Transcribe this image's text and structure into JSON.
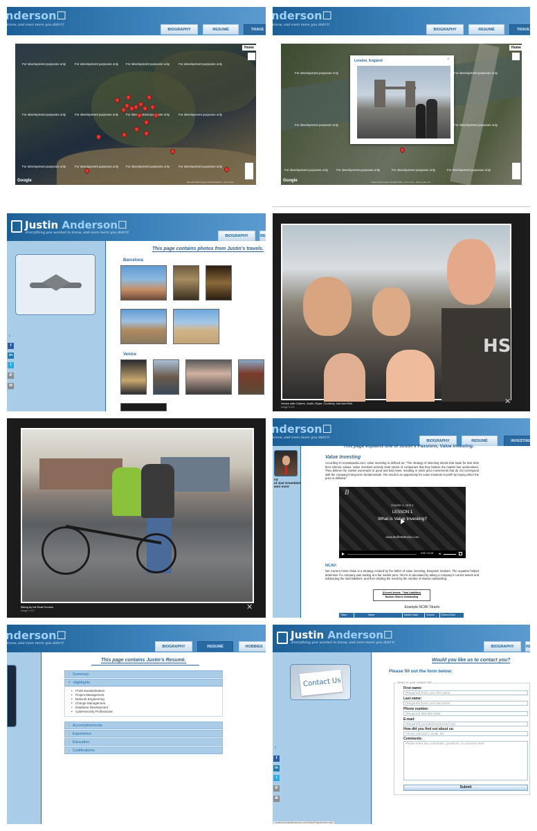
{
  "site": {
    "logo_first": "Justin",
    "logo_last": "Anderson",
    "tagline": "Everything you wanted to know, and even more you didn't!",
    "logo_partial": "nderson",
    "tagline_partial": "know, and even more you didn't!"
  },
  "nav": {
    "biography": "BIOGRAPHY",
    "resume": "RESUMÉ",
    "travels_partial": "TRAVE",
    "investing": "INVESTING",
    "hobbies_partial": "HOBBIES"
  },
  "map": {
    "dev_text": "For development purposes only",
    "home_button": "Home",
    "google_logo": "Google",
    "attribution": "Map data ©2018 Imagery ©2018 TerraMetrics · Terms of Use",
    "attribution_b": "Imagery ©2018 Google, Map data ©2018 · Terms of Use · Report a map error"
  },
  "infowindow": {
    "title": "London, England"
  },
  "travels": {
    "page_title": "This page contains photos from Justin's travels.",
    "section_barcelona": "Barcelona",
    "section_venice": "Venice",
    "back_arrow": "‹"
  },
  "social": {
    "facebook": "f",
    "linkedin": "in",
    "twitter": "t",
    "phone": "✆",
    "email": "✉"
  },
  "lightbox_venice": {
    "caption": "Venice with Colleen, Justin, Ryan, Courtney, and Ash-Rish",
    "counter": "Image 5 of 6",
    "close": "✕"
  },
  "lightbox_bike": {
    "caption": "Biking by the Boat Houses",
    "counter": "Image 3 of 5",
    "close": "✕"
  },
  "investing": {
    "banner_partial": "This page explains one of Justin's Passions, Value Investing.",
    "sidebar_name": "nd",
    "sidebar_quote": "of Joel Greenblatt",
    "sidebar_learn": "earn more",
    "heading1": "Value Investing",
    "para1_link": "Investopedia.com",
    "para1": "According to Investopedia.com, value investing is defined as: \"The strategy of selecting stocks that trade for less than their intrinsic values. Value investors actively seek stocks of companies that they believe the market has undervalued. They believe the market overreacts to good and bad news, resulting in stock price movements that do not correspond with the company's long-term fundamentals. The result is an opportunity for value investors to profit by buying when the price is deflated.\"",
    "video_brand": "B",
    "video_course": "Course 1, Unit 1",
    "video_lesson": "LESSON 1",
    "video_title": "What is Value Investing?",
    "video_site": "www.BuffettsBooks.com",
    "video_time": "0:00 / 11:25",
    "heading2": "NCAV:",
    "para2": "Net Current Asset Value is a strategy created by the father of value investing, Benjamin Graham. The equation helped determine if a company was trading at a fair market price. NCAV is calculated by taking a company's current assets and subtracting the total liabilities, and then dividing the result by the number of shares outstanding.",
    "formula_top": "(Current Assets - Total Liabilities)",
    "formula_bottom": "Number Shares Outstanding",
    "table_caption": "Example NCAV Stocks",
    "table_headers": [
      "Ticker",
      "Name",
      "Market Value",
      "Volume",
      "Return/Cash"
    ]
  },
  "resume": {
    "page_title": "This page contains Justin's Resumé.",
    "sections": [
      "Summary",
      "Highlights",
      "Accomplishments",
      "Experience",
      "Education",
      "Certifications"
    ],
    "highlights": [
      "ITSM standardization",
      "Project Management",
      "Network Engineering",
      "Change Management",
      "Database Development",
      "Cybersecurity Professional"
    ]
  },
  "contact": {
    "page_title": "Would you like us to contact you?",
    "subtitle": "Please fill out the form below:",
    "card_text": "Contact Us",
    "legend": "Send us your contact info",
    "fields": [
      {
        "label": "First name:",
        "placeholder": "(Required) Enter your first name"
      },
      {
        "label": "Last name:",
        "placeholder": "(Required) Enter your last name"
      },
      {
        "label": "Phone number:",
        "placeholder": "(Required) 555-555-5555"
      },
      {
        "label": "E-mail:",
        "placeholder": "(Required) youraddress@email.com"
      },
      {
        "label": "How did you find out about us:",
        "placeholder": "Friend, television, email, etc."
      }
    ],
    "comments_label": "Comments:",
    "comments_placeholder": "Please enter any comments, questions, or concerns here",
    "submit": "Submit",
    "footer": "localhost/JustinAnderson.com/ClientProject/Index.html"
  },
  "colors": {
    "header_dark": "#1c5f96",
    "header_light": "#5b9bcf",
    "sidebar": "#a9cde9",
    "accent": "#2a6aa3",
    "pin": "#e03a32"
  }
}
